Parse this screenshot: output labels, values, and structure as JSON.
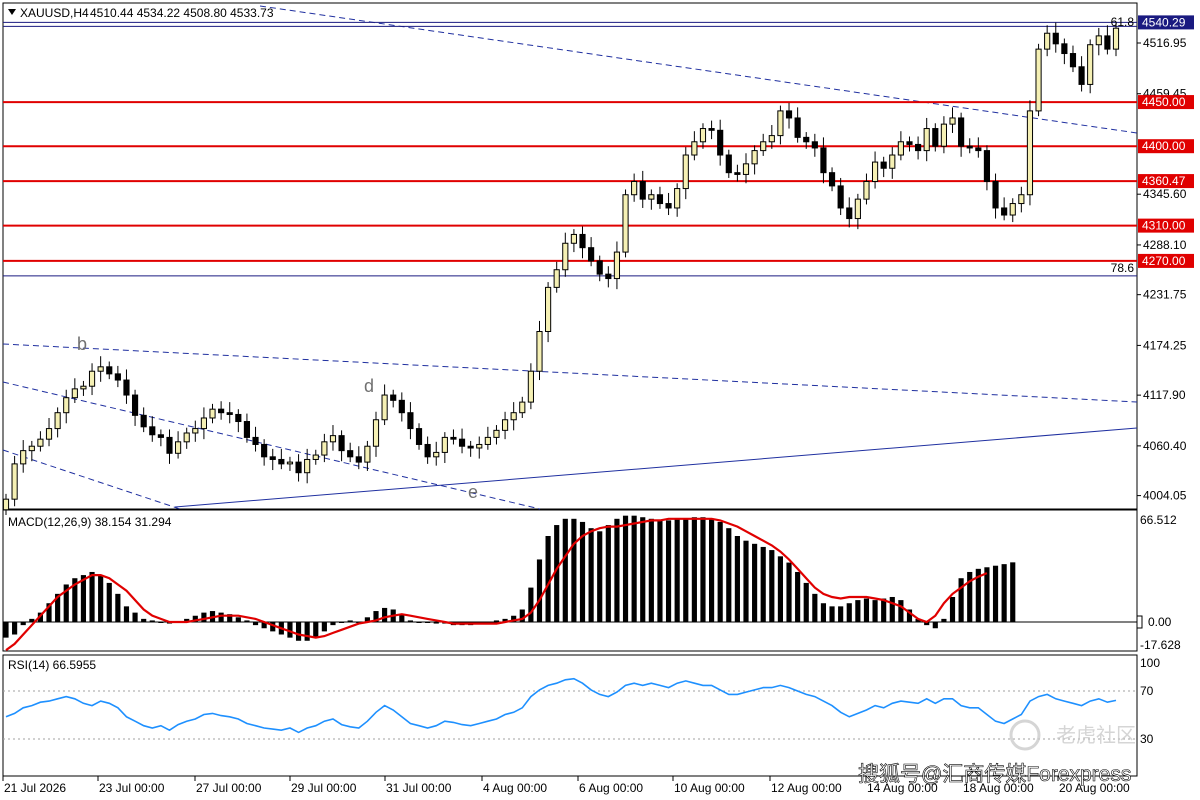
{
  "header": {
    "symbol_label": "XAUUSD,H4",
    "ohlc_label": "4510.44 4534.22 4508.80 4533.73"
  },
  "colors": {
    "background": "#ffffff",
    "candle_up_fill": "#f5f0b4",
    "candle_down_fill": "#000000",
    "candle_border": "#000000",
    "support_resistance": "#e00000",
    "fib_line": "#1a1a80",
    "trend_dashed": "#2030a0",
    "macd_signal": "#e00000",
    "rsi_line": "#1e90ff",
    "price_tag_bg": "#e00000",
    "price_tag_text": "#ffffff"
  },
  "chart_data": [
    {
      "type": "line",
      "title": "",
      "series_label": "XAUUSD,H4 (candlestick)",
      "ylim": [
        3990,
        4560
      ],
      "price_ticks": [
        "4516.95",
        "4459.45",
        "4345.60",
        "4288.10",
        "4231.75",
        "4174.25",
        "4117.90",
        "4060.40",
        "4004.05"
      ],
      "x_labels": [
        "21 Jul 2026",
        "23 Jul 00:00",
        "27 Jul 00:00",
        "29 Jul 00:00",
        "31 Jul 00:00",
        "4 Aug 00:00",
        "6 Aug 00:00",
        "10 Aug 00:00",
        "12 Aug 00:00",
        "14 Aug 00:00",
        "18 Aug 00:00",
        "20 Aug 00:00"
      ],
      "horizontal_levels": [
        {
          "price": 4540.29,
          "label": "4540.29",
          "style": "fib"
        },
        {
          "price": 4450.0,
          "label": "4450.00",
          "style": "red"
        },
        {
          "price": 4400.0,
          "label": "4400.00",
          "style": "red"
        },
        {
          "price": 4360.47,
          "label": "4360.47",
          "style": "red"
        },
        {
          "price": 4310.0,
          "label": "4310.00",
          "style": "red"
        },
        {
          "price": 4270.0,
          "label": "4270.00",
          "style": "red"
        },
        {
          "price": 4253.0,
          "label": "",
          "style": "fib"
        }
      ],
      "fib_labels": [
        "61.8",
        "78.6"
      ],
      "wave_labels": [
        "b",
        "d",
        "e"
      ],
      "close": [
        4000,
        4040,
        4055,
        4060,
        4068,
        4080,
        4098,
        4115,
        4125,
        4128,
        4145,
        4150,
        4142,
        4135,
        4118,
        4095,
        4082,
        4073,
        4070,
        4052,
        4065,
        4075,
        4080,
        4092,
        4102,
        4098,
        4096,
        4088,
        4070,
        4062,
        4048,
        4045,
        4040,
        4042,
        4030,
        4045,
        4050,
        4065,
        4072,
        4055,
        4048,
        4042,
        4060,
        4090,
        4118,
        4112,
        4098,
        4080,
        4062,
        4048,
        4053,
        4070,
        4068,
        4060,
        4058,
        4062,
        4070,
        4078,
        4090,
        4098,
        4110,
        4145,
        4190,
        4240,
        4260,
        4290,
        4300,
        4285,
        4270,
        4255,
        4250,
        4280,
        4345,
        4360,
        4340,
        4345,
        4335,
        4330,
        4352,
        4390,
        4405,
        4420,
        4418,
        4390,
        4370,
        4368,
        4380,
        4395,
        4405,
        4412,
        4440,
        4432,
        4410,
        4405,
        4398,
        4370,
        4355,
        4330,
        4318,
        4340,
        4360,
        4382,
        4375,
        4390,
        4405,
        4402,
        4395,
        4420,
        4400,
        4425,
        4432,
        4400,
        4398,
        4395,
        4360,
        4330,
        4322,
        4335,
        4345,
        4440,
        4510,
        4528,
        4516,
        4505,
        4490,
        4470,
        4515,
        4525,
        4510,
        4533.73
      ],
      "macd_title": "MACD(12,26,9) 38.154 31.294",
      "macd_ticks": [
        "66.512",
        "0.00",
        "-17.628"
      ],
      "macd_hist": [
        -10,
        -8,
        -2,
        2,
        6,
        12,
        18,
        24,
        28,
        30,
        32,
        30,
        25,
        18,
        10,
        6,
        2,
        1,
        0,
        -1,
        0,
        2,
        4,
        6,
        7,
        6,
        5,
        3,
        1,
        -2,
        -4,
        -6,
        -8,
        -10,
        -12,
        -12,
        -10,
        -6,
        -2,
        0,
        1,
        0,
        3,
        7,
        9,
        8,
        5,
        1,
        0,
        0,
        -1,
        -1,
        -2,
        -2,
        -2,
        -1,
        0,
        1,
        2,
        4,
        8,
        22,
        40,
        55,
        62,
        66,
        66,
        64,
        60,
        58,
        62,
        66,
        68,
        68,
        67,
        66,
        65,
        65,
        66,
        66,
        67,
        67,
        66,
        64,
        60,
        55,
        52,
        50,
        48,
        46,
        42,
        38,
        32,
        25,
        18,
        12,
        10,
        10,
        12,
        14,
        15,
        14,
        15,
        16,
        14,
        8,
        2,
        -2,
        -4,
        2,
        16,
        28,
        32,
        34,
        35,
        36,
        37,
        38.154
      ],
      "macd_signal": [
        -18,
        -14,
        -8,
        -2,
        4,
        10,
        16,
        20,
        24,
        27,
        30,
        30,
        28,
        24,
        20,
        14,
        8,
        4,
        2,
        0,
        0,
        0,
        1,
        2,
        3,
        4,
        4,
        4,
        3,
        2,
        0,
        -2,
        -4,
        -6,
        -8,
        -9,
        -10,
        -9,
        -7,
        -5,
        -3,
        -1,
        0,
        1,
        3,
        4,
        5,
        4,
        3,
        2,
        1,
        0,
        -1,
        -1,
        -1,
        -1,
        -1,
        -1,
        0,
        1,
        2,
        6,
        14,
        24,
        34,
        42,
        50,
        55,
        58,
        60,
        61,
        61,
        62,
        63,
        64,
        65,
        65,
        66,
        66,
        66,
        66,
        66,
        66,
        65,
        63,
        61,
        58,
        55,
        52,
        49,
        45,
        40,
        34,
        28,
        22,
        18,
        16,
        15,
        16,
        16,
        16,
        15,
        14,
        12,
        10,
        6,
        2,
        0,
        4,
        12,
        18,
        22,
        26,
        29,
        31.294
      ],
      "rsi_title": "RSI(14) 66.5955",
      "rsi_ticks": [
        "100",
        "70",
        "30"
      ],
      "rsi_levels": [
        70,
        30
      ],
      "rsi": [
        52,
        55,
        60,
        62,
        65,
        66,
        68,
        70,
        68,
        64,
        62,
        66,
        64,
        60,
        52,
        48,
        44,
        42,
        44,
        40,
        45,
        48,
        50,
        54,
        55,
        53,
        52,
        50,
        46,
        44,
        42,
        41,
        40,
        42,
        38,
        42,
        44,
        48,
        50,
        45,
        43,
        42,
        48,
        56,
        62,
        58,
        52,
        46,
        44,
        42,
        44,
        48,
        47,
        45,
        44,
        46,
        48,
        50,
        54,
        56,
        60,
        70,
        76,
        80,
        82,
        85,
        86,
        82,
        76,
        72,
        70,
        74,
        80,
        82,
        80,
        82,
        80,
        78,
        82,
        84,
        82,
        80,
        80,
        76,
        72,
        72,
        74,
        76,
        78,
        78,
        80,
        78,
        75,
        72,
        70,
        66,
        62,
        56,
        52,
        55,
        58,
        62,
        60,
        64,
        66,
        65,
        64,
        68,
        64,
        68,
        68,
        62,
        60,
        60,
        54,
        48,
        46,
        50,
        54,
        66,
        70,
        72,
        68,
        66,
        64,
        62,
        66,
        68,
        65,
        66.5955
      ]
    }
  ],
  "watermark": {
    "tiger_text": "老虎社区",
    "sohu_text": "搜狐号@汇商传媒Forexpress"
  }
}
